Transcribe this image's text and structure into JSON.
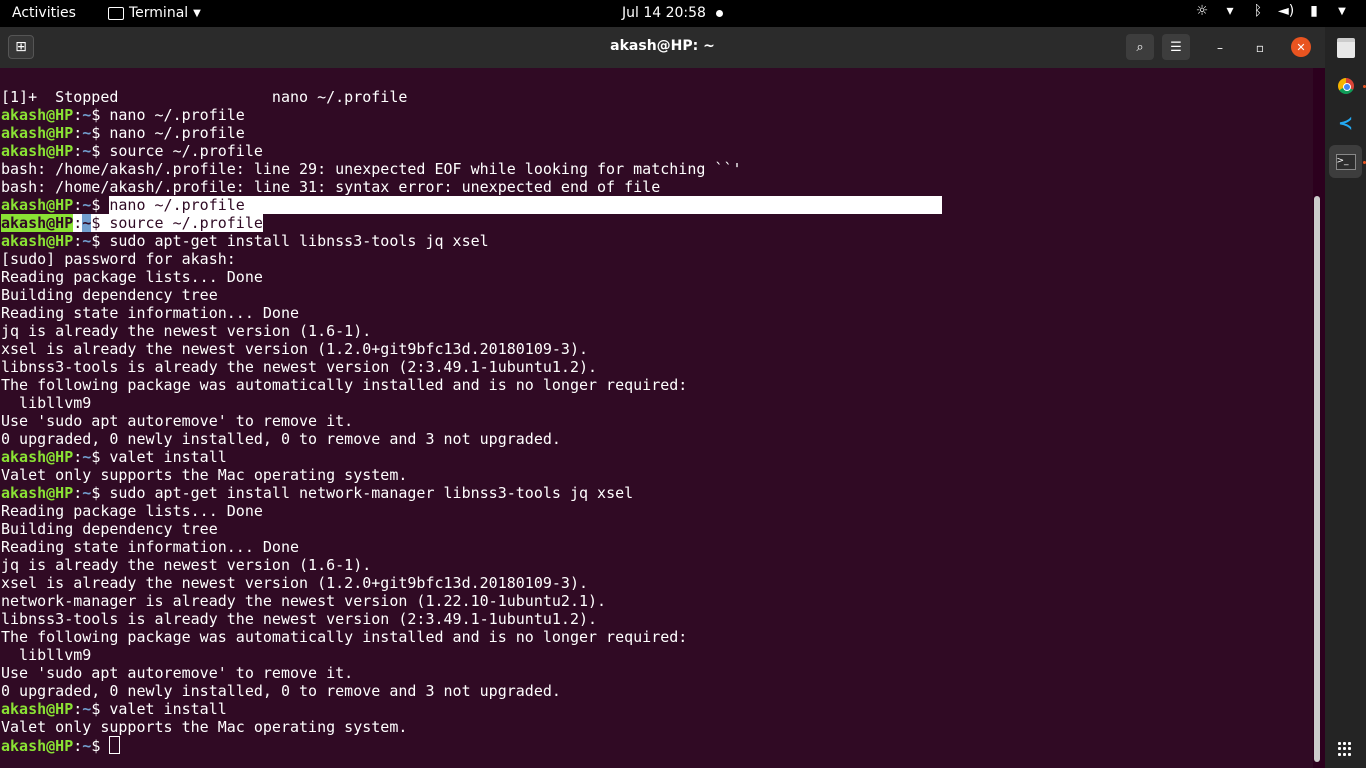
{
  "topbar": {
    "activities": "Activities",
    "app_name": "Terminal",
    "clock": "Jul 14  20:58"
  },
  "window": {
    "title": "akash@HP: ~"
  },
  "terminal": {
    "user": "akash@HP",
    "path": "~",
    "lines": [
      {
        "type": "out",
        "text": "[1]+  Stopped                 nano ~/.profile"
      },
      {
        "type": "prompt",
        "cmd": "nano ~/.profile"
      },
      {
        "type": "prompt",
        "cmd": "nano ~/.profile"
      },
      {
        "type": "prompt",
        "cmd": "source ~/.profile"
      },
      {
        "type": "out",
        "text": "bash: /home/akash/.profile: line 29: unexpected EOF while looking for matching ``'"
      },
      {
        "type": "out",
        "text": "bash: /home/akash/.profile: line 31: syntax error: unexpected end of file"
      },
      {
        "type": "prompt",
        "cmd": "nano ~/.profile",
        "selected": "cmd"
      },
      {
        "type": "prompt",
        "cmd": "source ~/.profile",
        "selected": "all"
      },
      {
        "type": "prompt",
        "cmd": "sudo apt-get install libnss3-tools jq xsel"
      },
      {
        "type": "out",
        "text": "[sudo] password for akash:"
      },
      {
        "type": "out",
        "text": "Reading package lists... Done"
      },
      {
        "type": "out",
        "text": "Building dependency tree"
      },
      {
        "type": "out",
        "text": "Reading state information... Done"
      },
      {
        "type": "out",
        "text": "jq is already the newest version (1.6-1)."
      },
      {
        "type": "out",
        "text": "xsel is already the newest version (1.2.0+git9bfc13d.20180109-3)."
      },
      {
        "type": "out",
        "text": "libnss3-tools is already the newest version (2:3.49.1-1ubuntu1.2)."
      },
      {
        "type": "out",
        "text": "The following package was automatically installed and is no longer required:"
      },
      {
        "type": "out",
        "text": "  libllvm9"
      },
      {
        "type": "out",
        "text": "Use 'sudo apt autoremove' to remove it."
      },
      {
        "type": "out",
        "text": "0 upgraded, 0 newly installed, 0 to remove and 3 not upgraded."
      },
      {
        "type": "prompt",
        "cmd": "valet install"
      },
      {
        "type": "out",
        "text": "Valet only supports the Mac operating system."
      },
      {
        "type": "prompt",
        "cmd": "sudo apt-get install network-manager libnss3-tools jq xsel"
      },
      {
        "type": "out",
        "text": "Reading package lists... Done"
      },
      {
        "type": "out",
        "text": "Building dependency tree"
      },
      {
        "type": "out",
        "text": "Reading state information... Done"
      },
      {
        "type": "out",
        "text": "jq is already the newest version (1.6-1)."
      },
      {
        "type": "out",
        "text": "xsel is already the newest version (1.2.0+git9bfc13d.20180109-3)."
      },
      {
        "type": "out",
        "text": "network-manager is already the newest version (1.22.10-1ubuntu2.1)."
      },
      {
        "type": "out",
        "text": "libnss3-tools is already the newest version (2:3.49.1-1ubuntu1.2)."
      },
      {
        "type": "out",
        "text": "The following package was automatically installed and is no longer required:"
      },
      {
        "type": "out",
        "text": "  libllvm9"
      },
      {
        "type": "out",
        "text": "Use 'sudo apt autoremove' to remove it."
      },
      {
        "type": "out",
        "text": "0 upgraded, 0 newly installed, 0 to remove and 3 not upgraded."
      },
      {
        "type": "prompt",
        "cmd": "valet install"
      },
      {
        "type": "out",
        "text": "Valet only supports the Mac operating system."
      },
      {
        "type": "prompt",
        "cmd": "",
        "cursor": true
      }
    ]
  },
  "dock": {
    "items": [
      {
        "icon": "files-icon"
      },
      {
        "icon": "chrome-icon"
      },
      {
        "icon": "vscode-icon"
      },
      {
        "icon": "terminal-icon",
        "active": true
      }
    ]
  },
  "colors": {
    "terminal_bg": "#300a24",
    "prompt_user": "#8ae234",
    "prompt_path": "#729fcf",
    "accent": "#e95420"
  }
}
